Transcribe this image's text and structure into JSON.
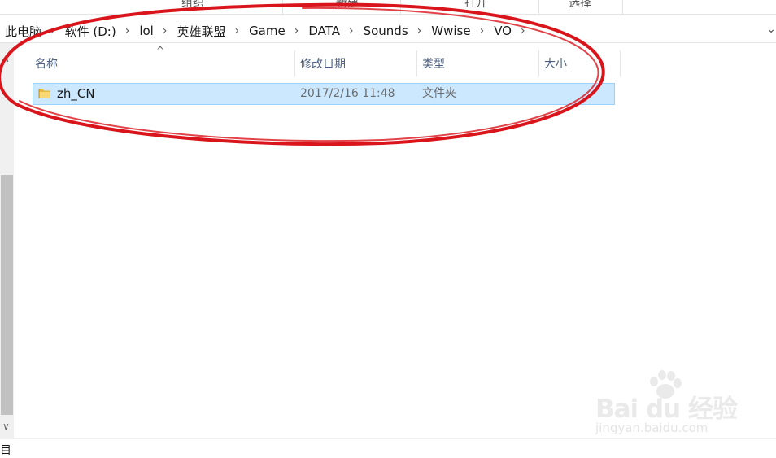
{
  "ribbon": {
    "groups": [
      "组织",
      "新建",
      "打开",
      "选择"
    ]
  },
  "address": {
    "crumbs": [
      "此电脑",
      "软件 (D:)",
      "lol",
      "英雄联盟",
      "Game",
      "DATA",
      "Sounds",
      "Wwise",
      "VO"
    ],
    "separator": "›"
  },
  "columns": {
    "name": "名称",
    "date": "修改日期",
    "type": "类型",
    "size": "大小"
  },
  "files": [
    {
      "name": "zh_CN",
      "date": "2017/2/16 11:48",
      "type": "文件夹",
      "size": "",
      "icon": "folder-icon",
      "selected": true
    }
  ],
  "status": {
    "text": "目"
  },
  "watermark": {
    "brand": "Bai du 经验",
    "url": "jingyan.baidu.com"
  },
  "colors": {
    "selection_bg": "#cce8ff",
    "selection_border": "#99d1ff",
    "annotation": "#d9141b",
    "header_text": "#4d6082"
  }
}
